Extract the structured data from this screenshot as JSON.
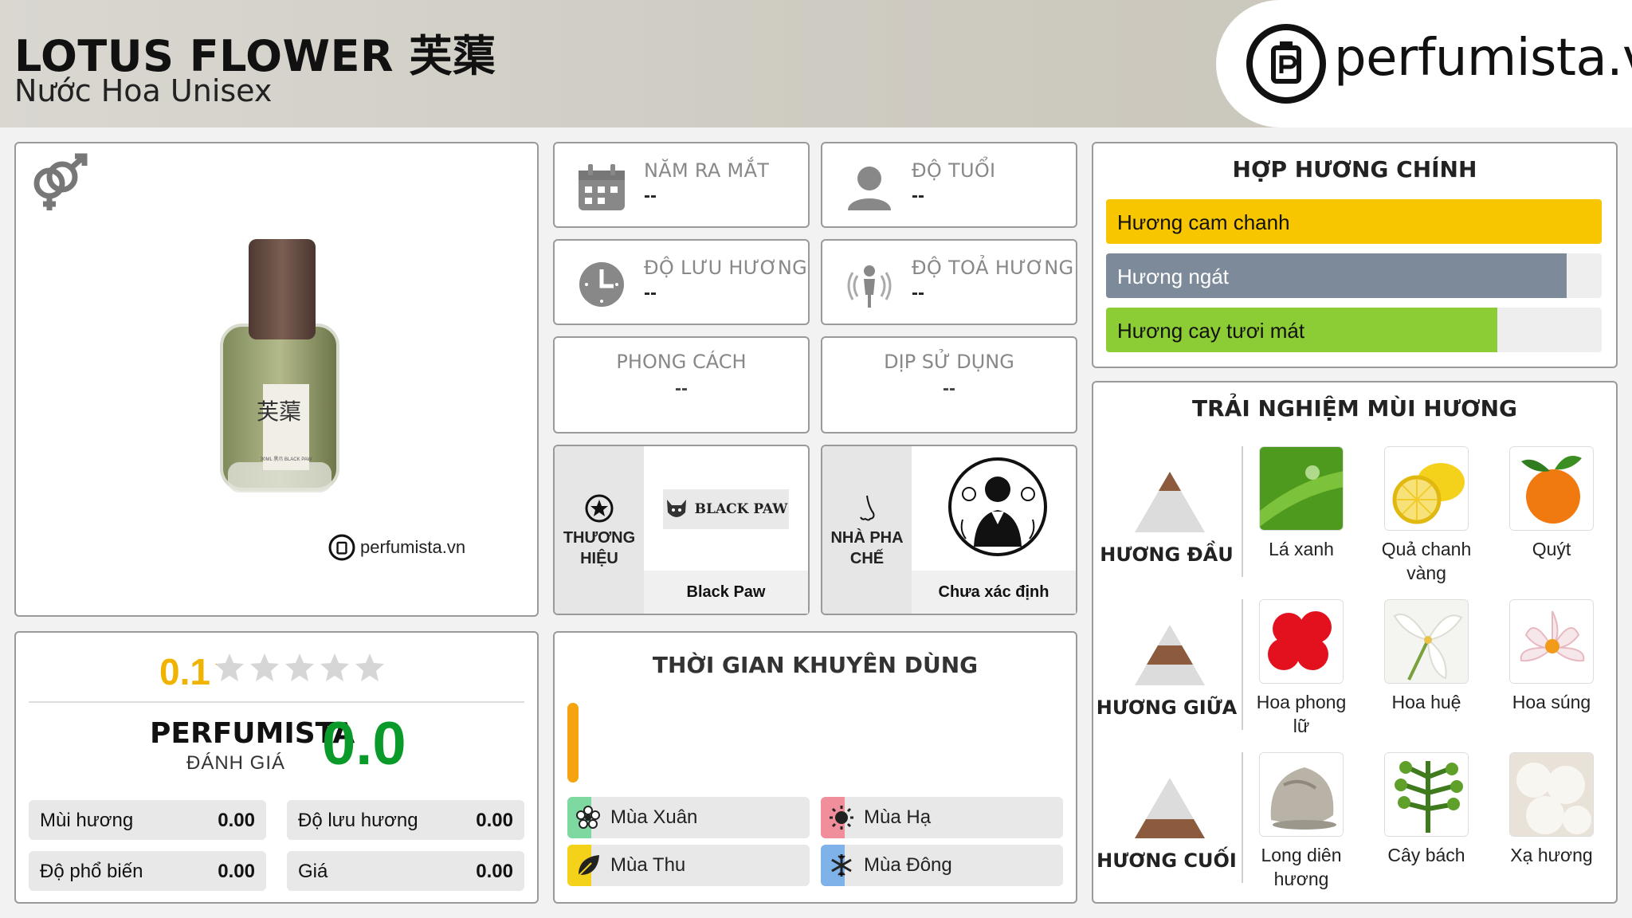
{
  "header": {
    "title": "LOTUS FLOWER 芙蕖",
    "subtitle": "Nước Hoa Unisex",
    "logo_text": "perfumista.vn"
  },
  "product": {
    "watermark": "perfumista.vn",
    "bottle_label": "芙蕖",
    "bottle_small": "30ML 黑爪 BLACK PAW",
    "gender_icon": "unisex-icon"
  },
  "stats": {
    "year": {
      "label": "NĂM RA MẮT",
      "value": "--",
      "icon": "calendar-icon"
    },
    "age": {
      "label": "ĐỘ TUỔI",
      "value": "--",
      "icon": "person-icon"
    },
    "longevity": {
      "label": "ĐỘ LƯU HƯƠNG",
      "value": "--",
      "icon": "clock-icon"
    },
    "sillage": {
      "label": "ĐỘ TOẢ HƯƠNG",
      "value": "--",
      "icon": "sillage-icon"
    },
    "style": {
      "label": "PHONG CÁCH",
      "value": "--"
    },
    "occasion": {
      "label": "DỊP SỬ DỤNG",
      "value": "--"
    }
  },
  "brand": {
    "side_label": "THƯƠNG HIỆU",
    "logo_text": "BLACK PAW",
    "name": "Black Paw"
  },
  "perfumer": {
    "side_label": "NHÀ PHA CHẾ",
    "name": "Chưa xác định"
  },
  "rating": {
    "user_score": "0.1",
    "star_level": 0.02,
    "pf_title": "PERFUMISTA",
    "pf_sub": "ĐÁNH GIÁ",
    "pf_score": "0.0",
    "metrics": [
      {
        "label": "Mùi hương",
        "value": "0.00"
      },
      {
        "label": "Độ lưu hương",
        "value": "0.00"
      },
      {
        "label": "Độ phổ biến",
        "value": "0.00"
      },
      {
        "label": "Giá",
        "value": "0.00"
      }
    ]
  },
  "time": {
    "title": "THỜI GIAN KHUYÊN DÙNG",
    "seasons": [
      {
        "label": "Mùa Xuân",
        "color": "#7ed9a0"
      },
      {
        "label": "Mùa Hạ",
        "color": "#f08f9b"
      },
      {
        "label": "Mùa Thu",
        "color": "#f5d21a"
      },
      {
        "label": "Mùa Đông",
        "color": "#7fb2e8"
      }
    ]
  },
  "accords": {
    "title": "HỢP HƯƠNG CHÍNH",
    "items": [
      {
        "label": "Hương cam chanh",
        "level": 1.0,
        "color": "#f7c600"
      },
      {
        "label": "Hương ngát",
        "level": 0.93,
        "color": "#7d8a99"
      },
      {
        "label": "Hương cay tươi mát",
        "level": 0.79,
        "color": "#8ccc35"
      }
    ]
  },
  "notes": {
    "title": "TRẢI NGHIỆM MÙI HƯƠNG",
    "tiers": [
      {
        "label": "HƯƠNG ĐẦU",
        "items": [
          "Lá xanh",
          "Quả chanh vàng",
          "Quýt"
        ]
      },
      {
        "label": "HƯƠNG GIỮA",
        "items": [
          "Hoa phong lữ",
          "Hoa huệ",
          "Hoa súng"
        ]
      },
      {
        "label": "HƯƠNG CUỐI",
        "items": [
          "Long diên hương",
          "Cây bách",
          "Xạ hương"
        ]
      }
    ]
  }
}
